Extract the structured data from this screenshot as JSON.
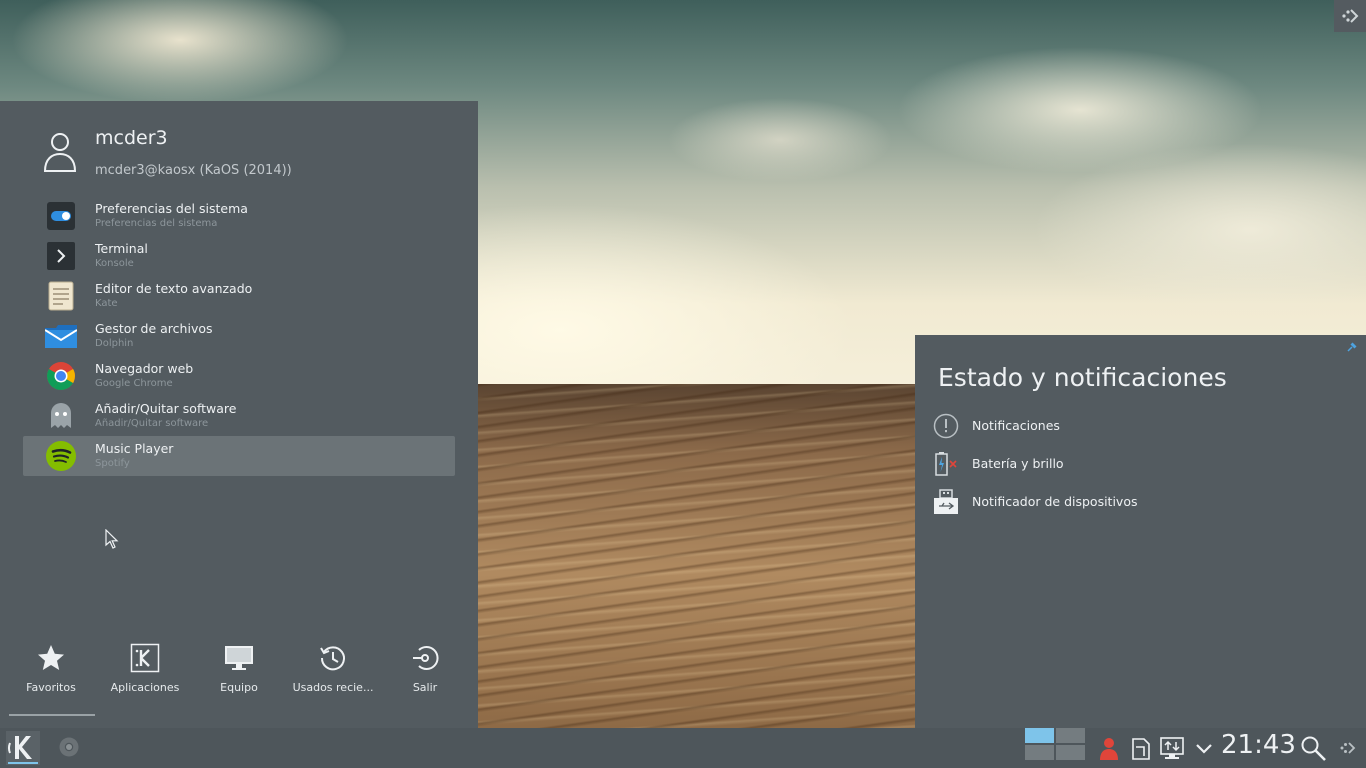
{
  "user": {
    "name": "mcder3",
    "host": "mcder3@kaosx (KaOS (2014))"
  },
  "favorites": [
    {
      "title": "Preferencias del sistema",
      "subtitle": "Preferencias del sistema",
      "icon": "toggle-icon"
    },
    {
      "title": "Terminal",
      "subtitle": "Konsole",
      "icon": "terminal-icon"
    },
    {
      "title": "Editor de texto avanzado",
      "subtitle": "Kate",
      "icon": "text-editor-icon"
    },
    {
      "title": "Gestor de archivos",
      "subtitle": "Dolphin",
      "icon": "folder-icon"
    },
    {
      "title": "Navegador web",
      "subtitle": "Google Chrome",
      "icon": "chrome-icon"
    },
    {
      "title": "Añadir/Quitar software",
      "subtitle": "Añadir/Quitar software",
      "icon": "ghost-icon"
    },
    {
      "title": "Music Player",
      "subtitle": "Spotify",
      "icon": "spotify-icon",
      "highlighted": true
    }
  ],
  "tabs": [
    {
      "label": "Favoritos",
      "icon": "star-icon"
    },
    {
      "label": "Aplicaciones",
      "icon": "kde-apps-icon"
    },
    {
      "label": "Equipo",
      "icon": "monitor-icon"
    },
    {
      "label": "Usados recie...",
      "icon": "history-icon"
    },
    {
      "label": "Salir",
      "icon": "logout-icon"
    }
  ],
  "status_panel": {
    "title": "Estado y notificaciones",
    "items": [
      {
        "label": "Notificaciones",
        "icon": "notification-icon"
      },
      {
        "label": "Batería y brillo",
        "icon": "battery-icon"
      },
      {
        "label": "Notificador de dispositivos",
        "icon": "device-notifier-icon"
      }
    ]
  },
  "taskbar": {
    "clock": "21:43"
  },
  "colors": {
    "panel_bg": "#535b60",
    "highlight": "#6b7377",
    "accent": "#7ec4ea",
    "spotify": "#84bd00"
  }
}
